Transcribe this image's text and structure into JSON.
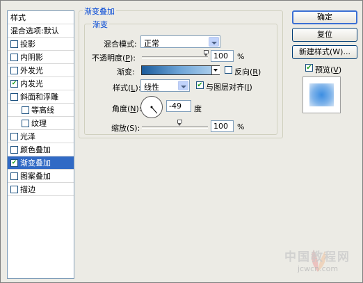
{
  "styles_panel": {
    "header": "样式",
    "blend_options": "混合选项:默认",
    "items": [
      {
        "label": "投影",
        "checked": false
      },
      {
        "label": "内阴影",
        "checked": false
      },
      {
        "label": "外发光",
        "checked": false
      },
      {
        "label": "内发光",
        "checked": true
      },
      {
        "label": "斜面和浮雕",
        "checked": false
      },
      {
        "label": "等高线",
        "checked": false
      },
      {
        "label": "纹理",
        "checked": false
      },
      {
        "label": "光泽",
        "checked": false
      },
      {
        "label": "颜色叠加",
        "checked": false
      },
      {
        "label": "渐变叠加",
        "checked": true,
        "selected": true
      },
      {
        "label": "图案叠加",
        "checked": false
      },
      {
        "label": "描边",
        "checked": false
      }
    ]
  },
  "gradient_overlay": {
    "group_title": "渐变叠加",
    "sub_title": "渐变",
    "blend_mode_label": "混合模式:",
    "blend_mode_value": "正常",
    "opacity_label_pre": "不透明度(",
    "opacity_label_key": "P",
    "opacity_label_post": "):",
    "opacity_value": "100",
    "opacity_unit": "%",
    "opacity_level": 1.0,
    "gradient_label": "渐变:",
    "reverse_label_pre": "反向(",
    "reverse_label_key": "R",
    "reverse_label_post": ")",
    "reverse_checked": false,
    "style_label_pre": "样式(",
    "style_label_key": "L",
    "style_label_post": "):",
    "style_value": "线性",
    "align_label_pre": "与图层对齐(",
    "align_label_key": "I",
    "align_label_post": ")",
    "align_checked": true,
    "angle_label_pre": "角度(",
    "angle_label_key": "N",
    "angle_label_post": "):",
    "angle_value": "-49",
    "angle_unit": "度",
    "scale_label": "缩放(S):",
    "scale_value": "100",
    "scale_unit": "%",
    "scale_level": 1.0
  },
  "buttons": {
    "ok": "确定",
    "reset": "复位",
    "new_style": "新建样式(W)...",
    "preview_pre": "预览(",
    "preview_key": "V",
    "preview_post": ")",
    "preview_checked": true
  },
  "watermark": {
    "line1": "中国教程网",
    "line2": "jcwcn.com"
  },
  "colors": {
    "selection": "#316ac5",
    "group_title": "#0046d5",
    "gradient_start": "#1b5c9c",
    "gradient_end": "#b7d6f0"
  }
}
